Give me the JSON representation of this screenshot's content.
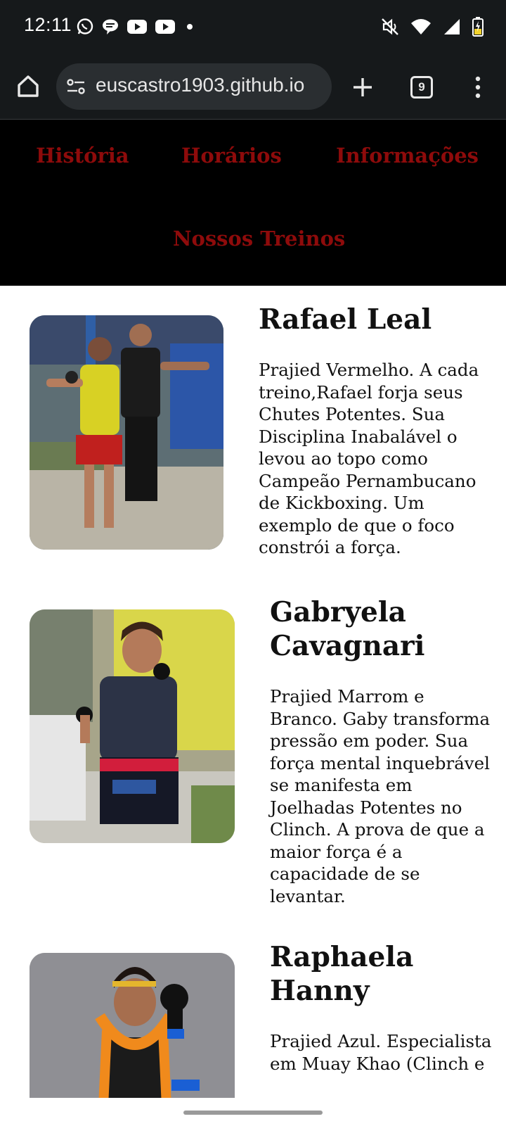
{
  "status_bar": {
    "time": "12:11",
    "left_icons": [
      "whatsapp-icon",
      "chat-bubble-icon",
      "youtube-icon",
      "youtube-icon",
      "dot-icon"
    ],
    "right_icons": [
      "mute-icon",
      "wifi-icon",
      "signal-icon",
      "battery-charging-icon"
    ]
  },
  "browser": {
    "url": "euscastro1903.github.io",
    "tab_count": "9"
  },
  "nav": {
    "links": [
      "História",
      "Horários",
      "Informações",
      "Nossos Treinos"
    ],
    "link_color": "#8e0b0b"
  },
  "athletes": [
    {
      "name": "Rafael Leal",
      "bio": "Prajied Vermelho. A cada treino,Rafael forja seus Chutes Potentes. Sua Disciplina Inabalável o levou ao topo como Campeão Pernambucano de Kickboxing. Um exemplo de que o foco constrói a força."
    },
    {
      "name": "Gabryela Cavagnari",
      "bio": "Prajied Marrom e Branco. Gaby transforma pressão em poder. Sua força mental inquebrável se manifesta em Joelhadas Potentes no Clinch. A prova de que a maior força é a capacidade de se levantar."
    },
    {
      "name": "Raphaela Hanny",
      "bio": "Prajied Azul. Especialista em Muay Khao (Clinch e"
    }
  ]
}
